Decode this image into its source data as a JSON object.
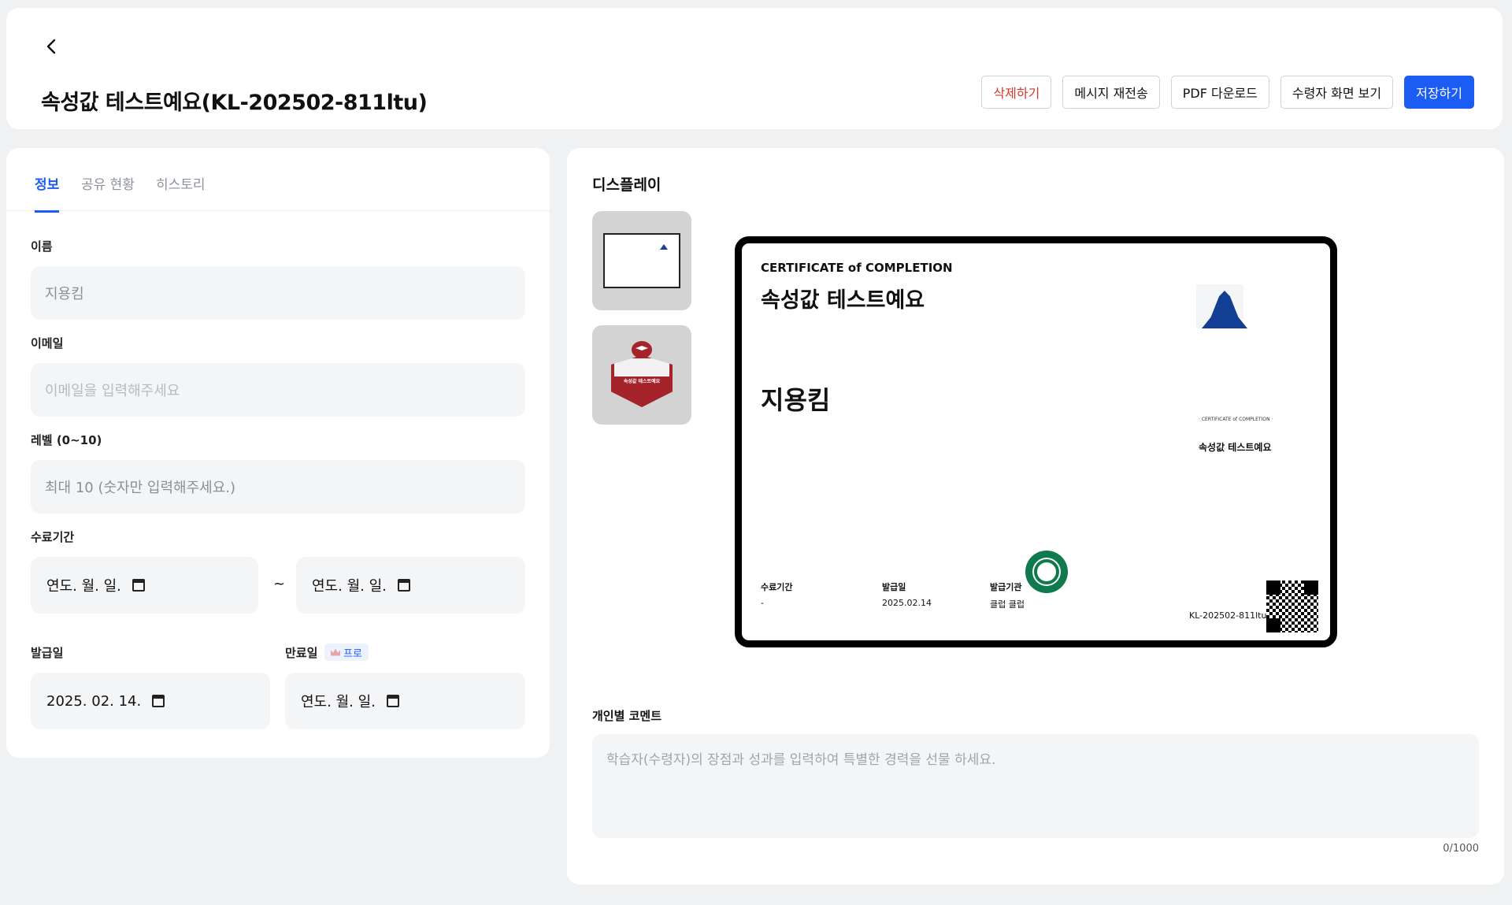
{
  "header": {
    "title": "속성값 테스트예요(KL-202502-811ltu)",
    "buttons": {
      "delete": "삭제하기",
      "resend": "메시지 재전송",
      "pdf": "PDF 다운로드",
      "preview": "수령자 화면 보기",
      "save": "저장하기"
    }
  },
  "tabs": [
    "정보",
    "공유 현황",
    "히스토리"
  ],
  "form": {
    "name_label": "이름",
    "name_value": "지용킴",
    "email_label": "이메일",
    "email_placeholder": "이메일을 입력해주세요",
    "level_label": "레벨 (0~10)",
    "level_placeholder": "최대 10 (숫자만 입력해주세요.)",
    "period_label": "수료기간",
    "period_start": "연도. 월. 일.",
    "period_sep": "~",
    "period_end": "연도. 월. 일.",
    "issue_label": "발급일",
    "issue_value": "2025. 02. 14.",
    "expire_label": "만료일",
    "pro_badge": "프로",
    "expire_value": "연도. 월. 일."
  },
  "display": {
    "title": "디스플레이",
    "badge_mini_header": "CERTIFICATE of COMPLETION",
    "badge_mini_course": "속성값 테스트예요"
  },
  "certificate": {
    "header": "CERTIFICATE of COMPLETION",
    "course": "속성값 테스트예요",
    "name": "지용킴",
    "sub_header": "· CERTIFICATE of COMPLETION ·",
    "sub_course": "속성값 테스트예요",
    "period_label": "수료기간",
    "period_value": "-",
    "issue_label": "발급일",
    "issue_value": "2025.02.14",
    "issuer_label": "발급기관",
    "issuer_value": "클럽 클럽",
    "code": "KL-202502-811ltu"
  },
  "comment": {
    "label": "개인별 코멘트",
    "placeholder": "학습자(수령자)의 장점과 성과를 입력하여 특별한 경력을 선물 하세요.",
    "counter": "0/1000"
  }
}
